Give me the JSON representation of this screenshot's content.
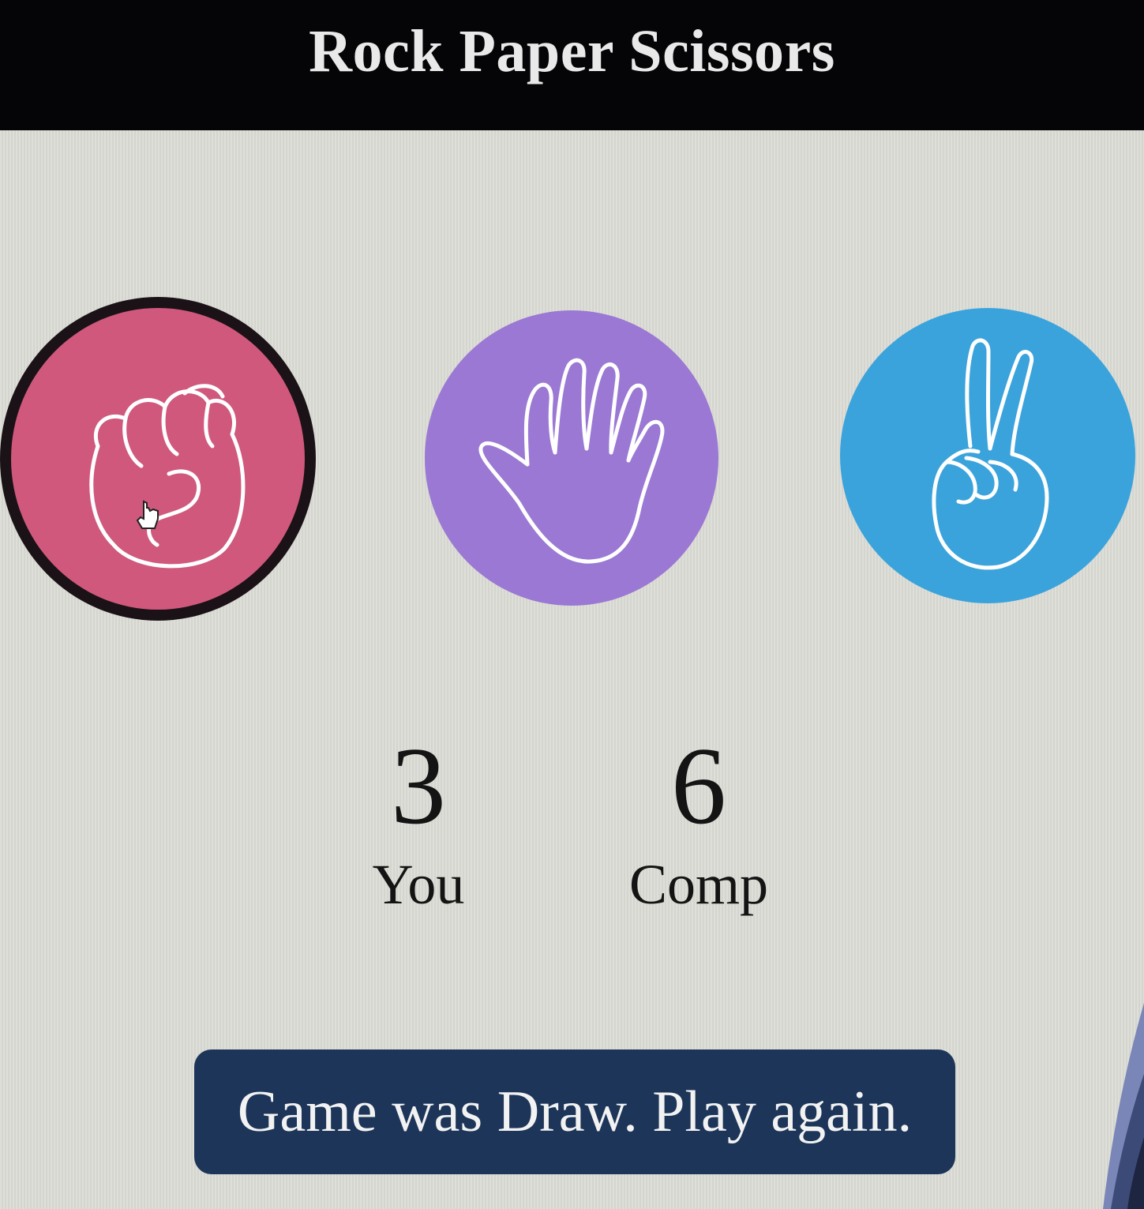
{
  "header": {
    "title": "Rock Paper Scissors"
  },
  "choices": [
    {
      "id": "rock",
      "icon": "fist-icon",
      "color": "#d0587d",
      "selected": true
    },
    {
      "id": "paper",
      "icon": "open-hand-icon",
      "color": "#9a78d4",
      "selected": false
    },
    {
      "id": "scissors",
      "icon": "peace-sign-icon",
      "color": "#3aa3dc",
      "selected": false
    }
  ],
  "scoreboard": {
    "you": {
      "score": "3",
      "label": "You"
    },
    "comp": {
      "score": "6",
      "label": "Comp"
    }
  },
  "result": {
    "message": "Game was Draw. Play again.",
    "color": "#1c3558"
  },
  "colors": {
    "header_bg": "#050507",
    "page_bg": "#dcdcd6"
  }
}
